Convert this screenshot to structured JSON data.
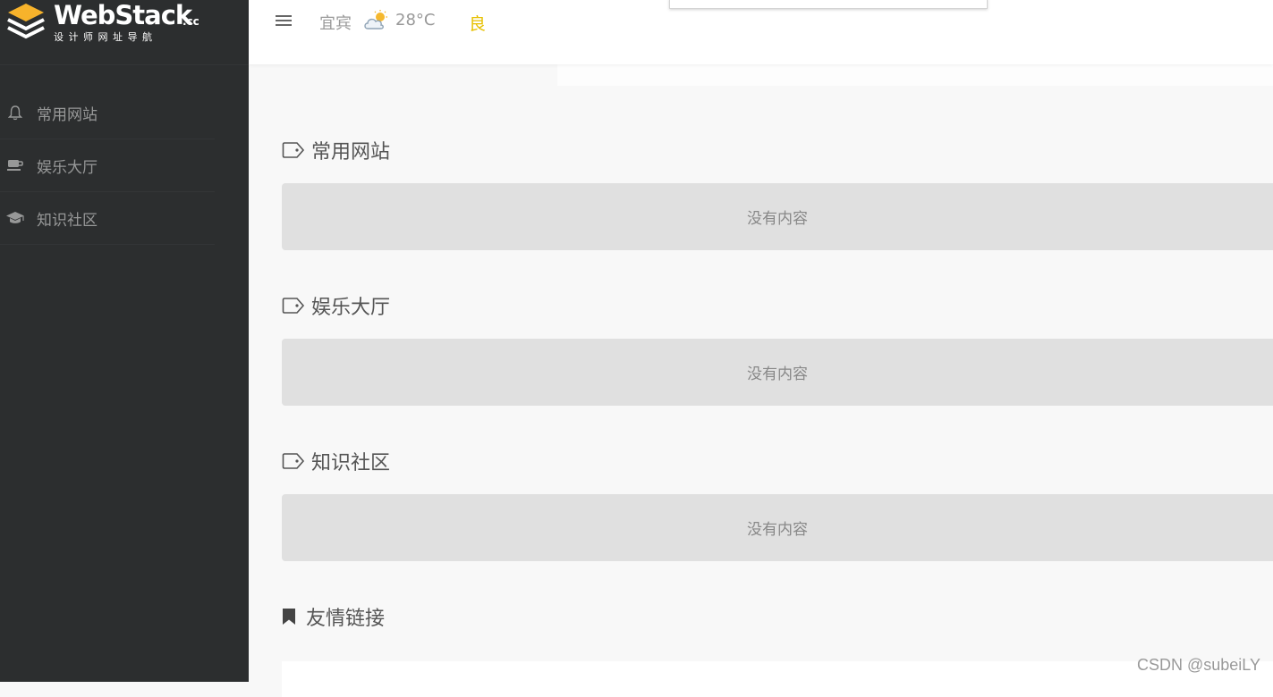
{
  "brand": {
    "name": "WebStack",
    "suffix": ".cc",
    "subtitle": "设计师网址导航"
  },
  "sidebar": {
    "items": [
      {
        "label": "常用网站",
        "icon": "bell-icon"
      },
      {
        "label": "娱乐大厅",
        "icon": "coffee-icon"
      },
      {
        "label": "知识社区",
        "icon": "graduation-cap-icon"
      }
    ]
  },
  "topbar": {
    "city": "宜宾",
    "temperature": "28°C",
    "air_quality": "良",
    "air_quality_color": "#e7c000"
  },
  "sections": [
    {
      "title": "常用网站",
      "empty_text": "没有内容"
    },
    {
      "title": "娱乐大厅",
      "empty_text": "没有内容"
    },
    {
      "title": "知识社区",
      "empty_text": "没有内容"
    }
  ],
  "friend_links": {
    "title": "友情链接"
  },
  "watermark": "CSDN @subeiLY"
}
